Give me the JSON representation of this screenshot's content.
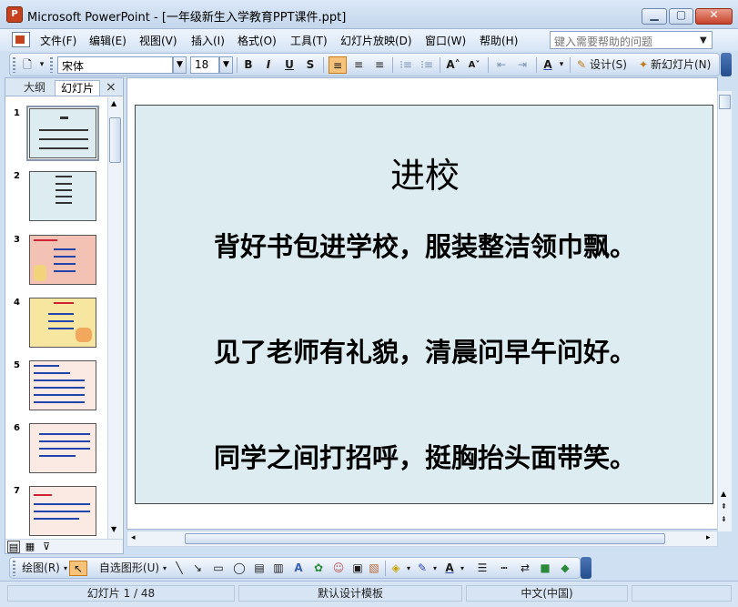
{
  "window": {
    "title": "Microsoft PowerPoint - [一年级新生入学教育PPT课件.ppt]"
  },
  "menu": {
    "items": [
      "文件(F)",
      "编辑(E)",
      "视图(V)",
      "插入(I)",
      "格式(O)",
      "工具(T)",
      "幻灯片放映(D)",
      "窗口(W)",
      "帮助(H)"
    ],
    "help_placeholder": "键入需要帮助的问题"
  },
  "toolbar": {
    "font_name": "宋体",
    "font_size": "18",
    "bold": "B",
    "italic": "I",
    "underline": "U",
    "shadow": "S",
    "design_label": "设计(S)",
    "new_slide_label": "新幻灯片(N)"
  },
  "left_panel": {
    "tab_outline": "大纲",
    "tab_slides": "幻灯片",
    "close": "×",
    "thumb_numbers": [
      "1",
      "2",
      "3",
      "4",
      "5",
      "6",
      "7"
    ]
  },
  "slide": {
    "title": "进校",
    "lines": [
      "背好书包进学校，服装整洁领巾飘。",
      "见了老师有礼貌，清晨问早午问好。",
      "同学之间打招呼，挺胸抬头面带笑。"
    ],
    "background": "#dcecf1"
  },
  "drawing_toolbar": {
    "draw_label": "绘图(R)",
    "autoshapes_label": "自选图形(U)"
  },
  "status": {
    "slide_info": "幻灯片 1 / 48",
    "template": "默认设计模板",
    "language": "中文(中国)"
  },
  "colors": {
    "accent": "#c6421e",
    "toolbar_active": "#f7c27a",
    "window_chrome": "#cfe0f2"
  }
}
